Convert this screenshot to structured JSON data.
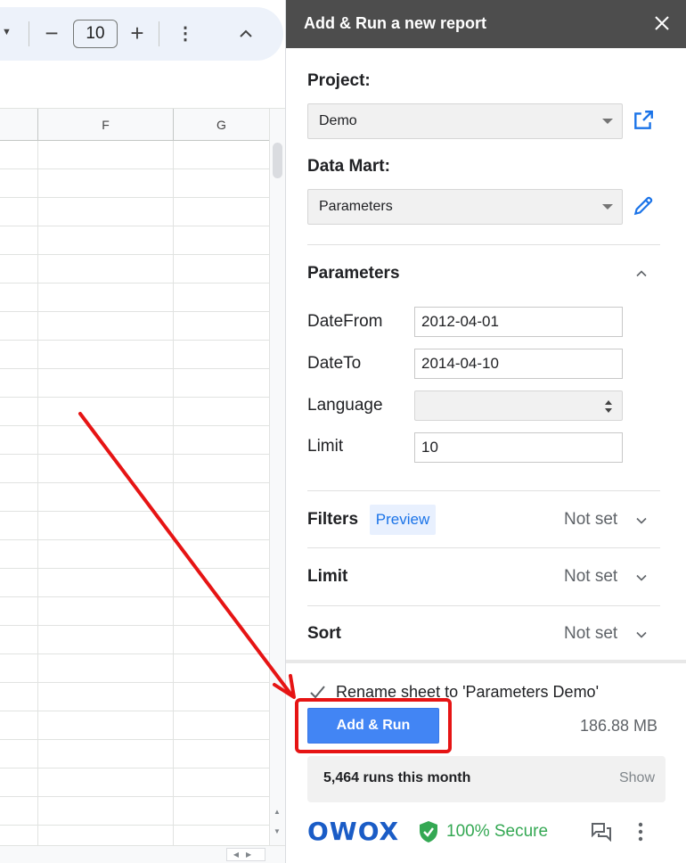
{
  "sheet": {
    "font_size": "10",
    "columns": [
      "F",
      "G"
    ]
  },
  "sidebar": {
    "title": "Add & Run a new report",
    "project_label": "Project:",
    "project_value": "Demo",
    "data_mart_label": "Data Mart:",
    "data_mart_value": "Parameters",
    "parameters": {
      "title": "Parameters",
      "fields": [
        {
          "label": "DateFrom",
          "value": "2012-04-01"
        },
        {
          "label": "DateTo",
          "value": "2014-04-10"
        },
        {
          "label": "Language",
          "value": ""
        },
        {
          "label": "Limit",
          "value": "10"
        }
      ]
    },
    "filters": {
      "title": "Filters",
      "preview_label": "Preview",
      "status": "Not set"
    },
    "limit": {
      "title": "Limit",
      "status": "Not set"
    },
    "sort": {
      "title": "Sort",
      "status": "Not set"
    },
    "rename_label": "Rename sheet to 'Parameters Demo'",
    "rename_checked": true,
    "add_run_label": "Add & Run",
    "data_size": "186.88 MB",
    "runs_text": "5,464 runs this month",
    "runs_show": "Show",
    "brand": "OWOX",
    "secure_label": "100% Secure"
  },
  "colors": {
    "header_bg": "#4d4d4d",
    "primary_button": "#4285f4",
    "link_blue": "#1a73e8",
    "secure_green": "#34a853",
    "annotation_red": "#e61414"
  }
}
